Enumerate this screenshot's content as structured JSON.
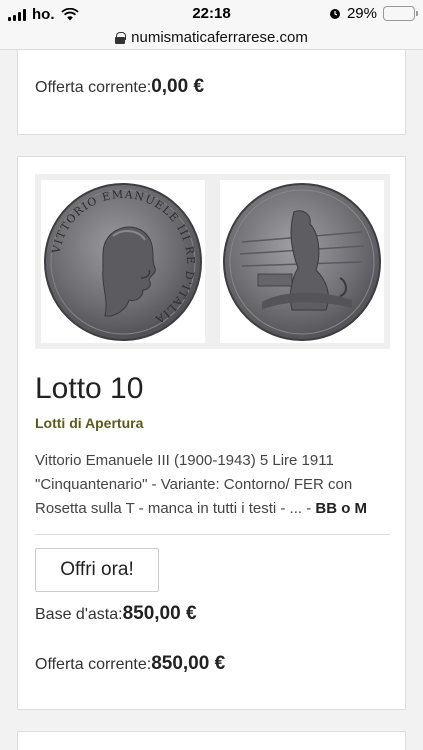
{
  "status_bar": {
    "carrier": "ho.",
    "time": "22:18",
    "battery_percent": "29%",
    "battery_level": 0.29,
    "battery_color": "#f5c518"
  },
  "browser": {
    "url": "numismaticaferrarese.com"
  },
  "previous_card": {
    "current_offer_label": "Offerta corrente:",
    "current_offer_value": "0,00 €"
  },
  "lot": {
    "title": "Lotto 10",
    "category": "Lotti di Apertura",
    "description": "Vittorio Emanuele III (1900-1943) 5 Lire 1911 \"Cinquantenario\" - Variante: Contorno/ FER con Rosetta sulla T - manca in tutti i testi - ... - ",
    "grade": "BB o M",
    "coin_obverse_legend": "VITTORIO EMANUELE III RE D'ITALIA",
    "offer_button": "Offri ora!",
    "base_label": "Base d'asta:",
    "base_value": "850,00 €",
    "current_offer_label": "Offerta corrente:",
    "current_offer_value": "850,00 €"
  },
  "colors": {
    "category": "#5b5b1f",
    "card_border": "#dddddd"
  }
}
